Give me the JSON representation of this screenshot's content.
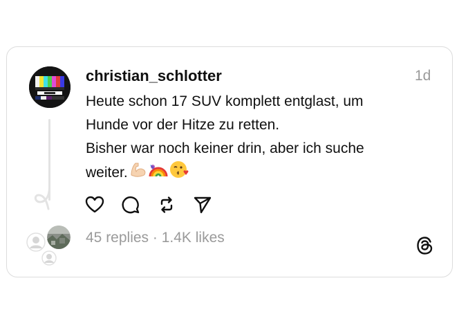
{
  "post": {
    "username": "christian_schlotter",
    "time": "1d",
    "lines": [
      "Heute schon 17 SUV komplett entglast, um",
      "Hunde vor der Hitze zu retten.",
      "Bisher war noch keiner drin, aber ich suche",
      "weiter."
    ],
    "emojis": [
      "flexed-biceps-emoji",
      "rainbow-emoji",
      "kissing-face-emoji"
    ]
  },
  "actions": {
    "like_icon": "heart-icon",
    "reply_icon": "comment-icon",
    "repost_icon": "repost-icon",
    "share_icon": "send-icon"
  },
  "stats": {
    "replies": "45 replies",
    "separator": " · ",
    "likes": "1.4K likes"
  },
  "branding": {
    "logo_icon": "threads-logo-icon"
  }
}
